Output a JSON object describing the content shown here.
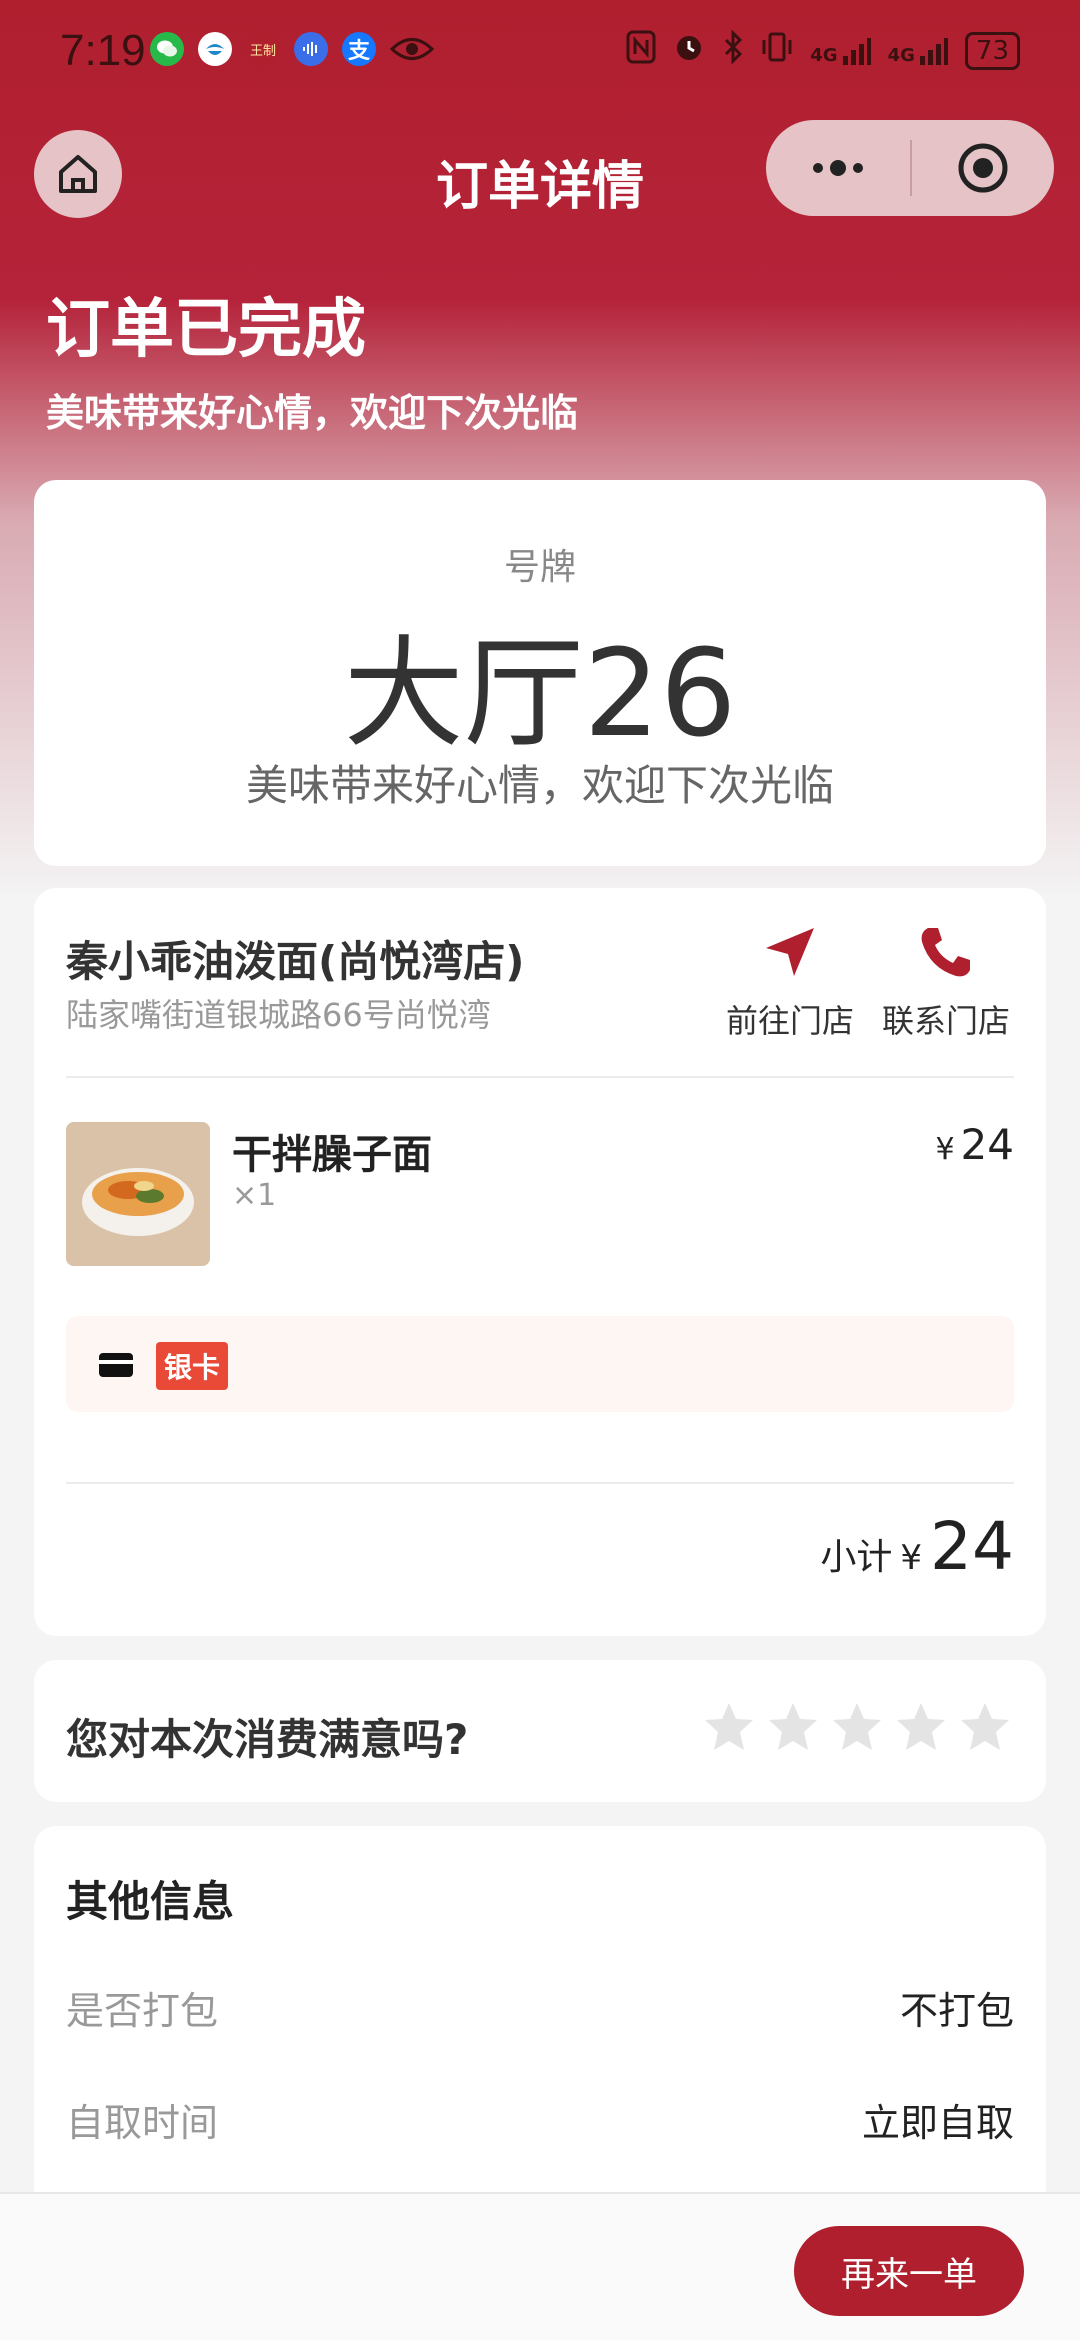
{
  "status_bar": {
    "time": "7:19",
    "network": "4G",
    "network2": "4G",
    "battery": "73",
    "app_icons": [
      "wechat-icon",
      "bird-icon",
      "wangzhi-icon",
      "voice-icon",
      "alipay-icon",
      "eye-icon"
    ],
    "app_icon_text": "王制",
    "alipay_glyph": "支"
  },
  "nav": {
    "title": "订单详情"
  },
  "order_status": {
    "title": "订单已完成",
    "subtitle": "美味带来好心情，欢迎下次光临"
  },
  "ticket": {
    "label": "号牌",
    "number": "大厅26",
    "message": "美味带来好心情，欢迎下次光临"
  },
  "store": {
    "name": "秦小乖油泼面(尚悦湾店)",
    "address": "陆家嘴街道银城路66号尚悦湾",
    "navigate_label": "前往门店",
    "call_label": "联系门店"
  },
  "items": [
    {
      "name": "干拌臊子面",
      "qty": "×1",
      "currency": "¥",
      "price": "24"
    }
  ],
  "payment": {
    "tag": "银卡"
  },
  "subtotal": {
    "label": "小计",
    "currency": "¥",
    "amount": "24"
  },
  "rating": {
    "question": "您对本次消费满意吗?",
    "stars_total": 5,
    "stars_selected": 0
  },
  "other_info": {
    "title": "其他信息",
    "rows": [
      {
        "key": "是否打包",
        "value": "不打包"
      },
      {
        "key": "自取时间",
        "value": "立即自取"
      }
    ]
  },
  "actions": {
    "reorder": "再来一单"
  },
  "colors": {
    "brand": "#b01f2e",
    "tag": "#e94a38"
  }
}
